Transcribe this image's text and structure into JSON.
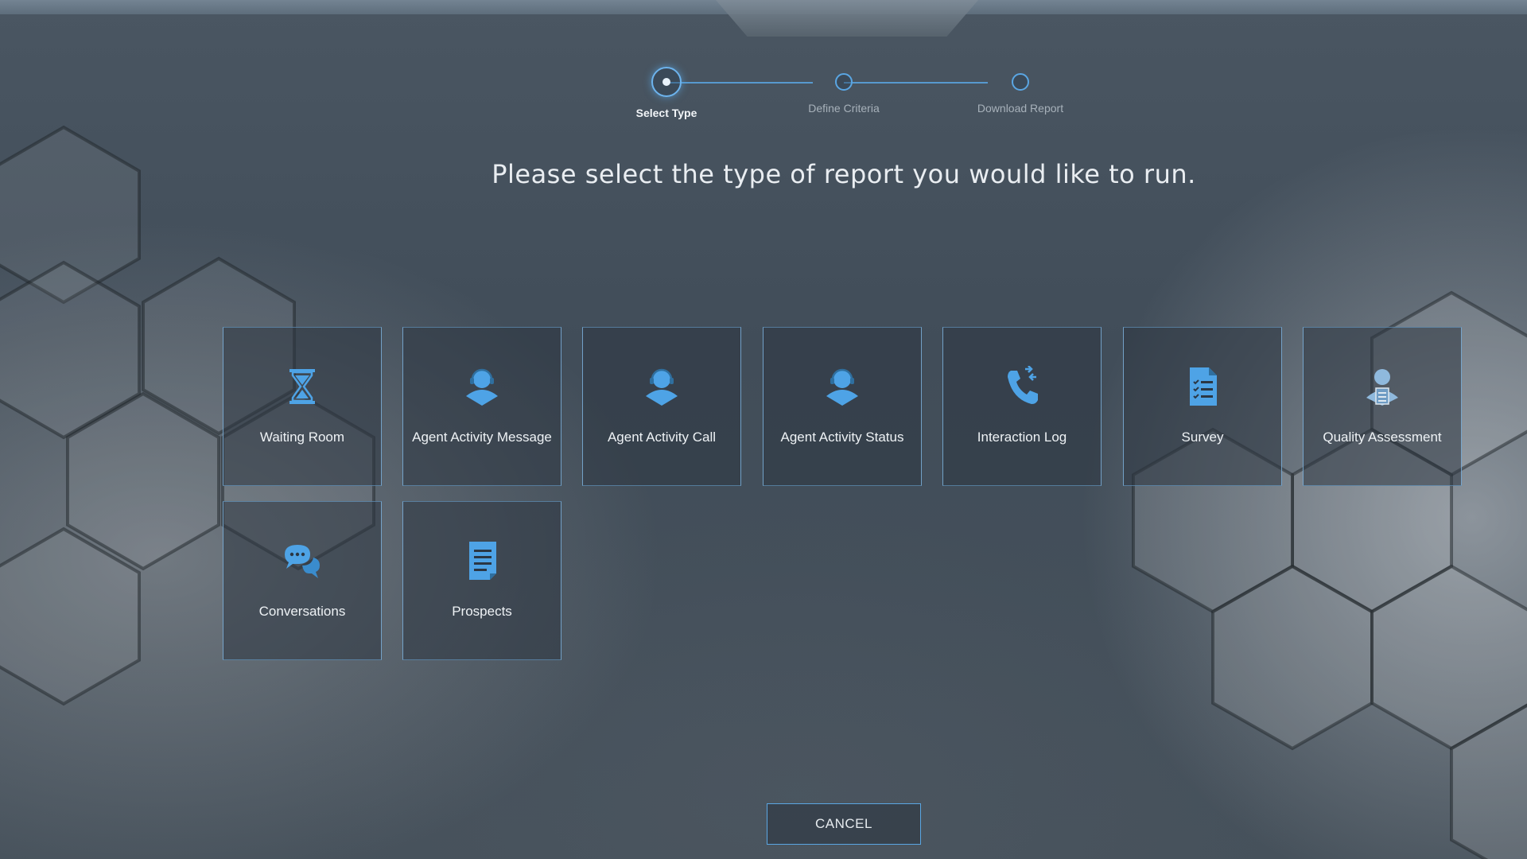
{
  "stepper": {
    "steps": [
      {
        "label": "Select Type",
        "active": true
      },
      {
        "label": "Define Criteria",
        "active": false
      },
      {
        "label": "Download Report",
        "active": false
      }
    ]
  },
  "heading": "Please select the type of report you would like to run.",
  "report_types": [
    {
      "label": "Waiting Room",
      "icon": "hourglass-icon"
    },
    {
      "label": "Agent Activity Message",
      "icon": "agent-headset-icon"
    },
    {
      "label": "Agent Activity Call",
      "icon": "agent-headset-icon"
    },
    {
      "label": "Agent Activity Status",
      "icon": "agent-headset-icon"
    },
    {
      "label": "Interaction Log",
      "icon": "phone-transfer-icon"
    },
    {
      "label": "Survey",
      "icon": "checklist-document-icon"
    },
    {
      "label": "Quality Assessment",
      "icon": "agent-clipboard-icon"
    },
    {
      "label": "Conversations",
      "icon": "chat-bubbles-icon"
    },
    {
      "label": "Prospects",
      "icon": "document-icon"
    }
  ],
  "cancel_label": "CANCEL",
  "colors": {
    "accent": "#5aa6e3",
    "icon": "#4ea3e6",
    "text": "#eef2f5"
  }
}
